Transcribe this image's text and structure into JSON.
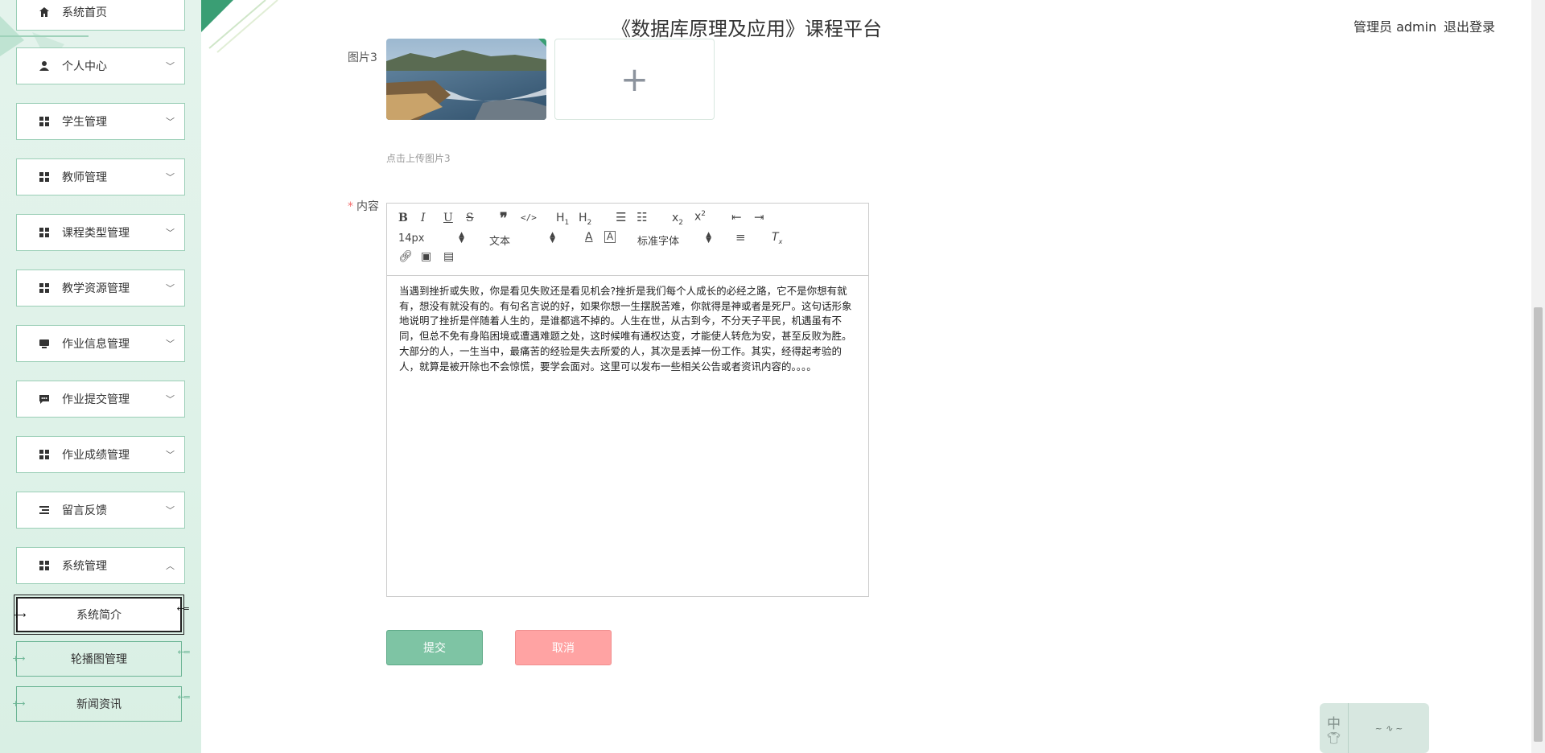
{
  "app": {
    "title": "《数据库原理及应用》课程平台",
    "user_label": "管理员 admin",
    "logout_label": "退出登录"
  },
  "sidebar": {
    "items": [
      {
        "label": "系统首页",
        "icon": "home-icon"
      },
      {
        "label": "个人中心",
        "icon": "user-icon",
        "chevron": "﹀"
      },
      {
        "label": "学生管理",
        "icon": "grid-icon",
        "chevron": "﹀"
      },
      {
        "label": "教师管理",
        "icon": "grid-icon",
        "chevron": "﹀"
      },
      {
        "label": "课程类型管理",
        "icon": "grid-icon",
        "chevron": "﹀"
      },
      {
        "label": "教学资源管理",
        "icon": "grid-icon",
        "chevron": "﹀"
      },
      {
        "label": "作业信息管理",
        "icon": "monitor-icon",
        "chevron": "﹀"
      },
      {
        "label": "作业提交管理",
        "icon": "chat-icon",
        "chevron": "﹀"
      },
      {
        "label": "作业成绩管理",
        "icon": "grid-icon",
        "chevron": "﹀"
      },
      {
        "label": "留言反馈",
        "icon": "list-icon",
        "chevron": "﹀"
      },
      {
        "label": "系统管理",
        "icon": "grid-icon",
        "chevron": "︿"
      }
    ],
    "sub_items": [
      {
        "label": "系统简介",
        "active": true
      },
      {
        "label": "轮播图管理",
        "active": false
      },
      {
        "label": "新闻资讯",
        "active": false
      }
    ]
  },
  "form": {
    "image3_label": "图片3",
    "image3_upload_plus": "+",
    "image3_tip": "点击上传图片3",
    "content_required_mark": "*",
    "content_label": "内容",
    "editor": {
      "font_size": "14px",
      "block_format": "文本",
      "font_family": "标准字体",
      "text": "当遇到挫折或失败，你是看见失败还是看见机会?挫折是我们每个人成长的必经之路，它不是你想有就有，想没有就没有的。有句名言说的好，如果你想一生摆脱苦难，你就得是神或者是死尸。这句话形象地说明了挫折是伴随着人生的，是谁都逃不掉的。人生在世，从古到今，不分天子平民，机遇虽有不同，但总不免有身陷困境或遭遇难题之处，这时候唯有通权达变，才能使人转危为安，甚至反败为胜。大部分的人，一生当中，最痛苦的经验是失去所爱的人，其次是丢掉一份工作。其实，经得起考验的人，就算是被开除也不会惊慌，要学会面对。这里可以发布一些相关公告或者资讯内容的。。。。"
    },
    "submit_label": "提交",
    "cancel_label": "取消"
  },
  "ime": {
    "mode": "中"
  },
  "colors": {
    "accent": "#7ec4a4",
    "cancel": "#ffa3a3",
    "sidebar_bg": "#e4f3ec"
  }
}
